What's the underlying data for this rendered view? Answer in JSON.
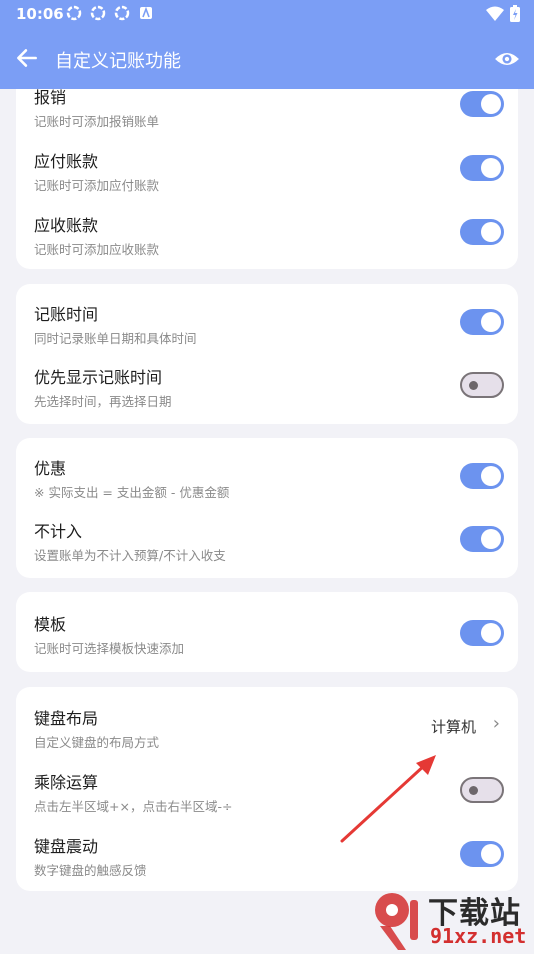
{
  "status": {
    "time": "10:06"
  },
  "appbar": {
    "title": "自定义记账功能"
  },
  "card1": {
    "rows": [
      {
        "title": "报销",
        "subtitle": "记账时可添加报销账单",
        "on": true
      },
      {
        "title": "应付账款",
        "subtitle": "记账时可添加应付账款",
        "on": true
      },
      {
        "title": "应收账款",
        "subtitle": "记账时可添加应收账款",
        "on": true
      }
    ]
  },
  "card2": {
    "rows": [
      {
        "title": "记账时间",
        "subtitle": "同时记录账单日期和具体时间",
        "on": true
      },
      {
        "title": "优先显示记账时间",
        "subtitle": "先选择时间，再选择日期",
        "on": false
      }
    ]
  },
  "card3": {
    "rows": [
      {
        "title": "优惠",
        "subtitle": "※ 实际支出 = 支出金额 - 优惠金额",
        "on": true
      },
      {
        "title": "不计入",
        "subtitle": "设置账单为不计入预算/不计入收支",
        "on": true
      }
    ]
  },
  "card4": {
    "rows": [
      {
        "title": "模板",
        "subtitle": "记账时可选择模板快速添加",
        "on": true
      }
    ]
  },
  "card5": {
    "keyboard": {
      "title": "键盘布局",
      "subtitle": "自定义键盘的布局方式",
      "value": "计算机"
    },
    "rows": [
      {
        "title": "乘除运算",
        "subtitle": "点击左半区域+×，点击右半区域-÷",
        "on": false
      },
      {
        "title": "键盘震动",
        "subtitle": "数字键盘的触感反馈",
        "on": true
      }
    ]
  },
  "watermark": {
    "text1": "下载站",
    "text2": "91xz.net"
  },
  "colors": {
    "primary": "#7b9ef5",
    "toggle_on": "#6c93ef",
    "arrow": "#e53935"
  }
}
